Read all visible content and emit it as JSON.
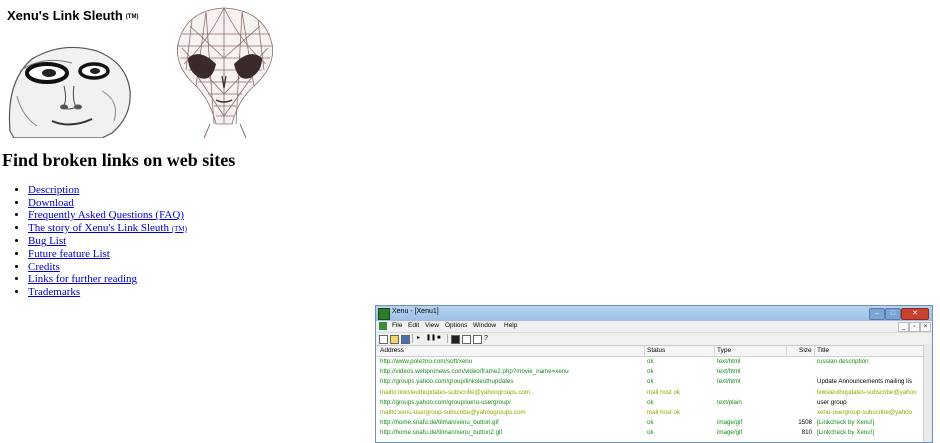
{
  "logo": {
    "title": "Xenu's Link Sleuth",
    "tm": "(TM)"
  },
  "headline": "Find broken links on web sites",
  "nav": {
    "items": [
      {
        "label": "Description"
      },
      {
        "label": "Download"
      },
      {
        "label": "Frequently Asked Questions (FAQ)"
      },
      {
        "label": "The story of Xenu's Link Sleuth",
        "suffix": "(TM)"
      },
      {
        "label": "Bug List"
      },
      {
        "label": "Future feature List"
      },
      {
        "label": "Credits"
      },
      {
        "label": "Links for further reading"
      },
      {
        "label": "Trademarks"
      }
    ]
  },
  "xenu_window": {
    "title": "Xenu - [Xenu1]",
    "menu": [
      "File",
      "Edit",
      "View",
      "Options",
      "Window",
      "Help"
    ],
    "columns": [
      "Address",
      "Status",
      "Type",
      "Size",
      "Title"
    ],
    "rows": [
      {
        "address": "http://www.polezno.com/soft/xenu",
        "status": "ok",
        "type": "text/html",
        "size": "",
        "title": "russian description",
        "kind": "ok"
      },
      {
        "address": "http://videos.webpronews.com/video/frame2.php?movie_name=xenu",
        "status": "ok",
        "type": "text/html",
        "size": "",
        "title": "",
        "kind": "ok"
      },
      {
        "address": "http://groups.yahoo.com/group/linksleuthupdates",
        "status": "ok",
        "type": "text/html",
        "size": "",
        "title": "Update Announcements mailing lis",
        "kind": "ok"
      },
      {
        "address": "mailto:linksleuthupdates-subscribe@yahoogroups.com",
        "status": "mail host ok",
        "type": "",
        "size": "",
        "title": "linksleuthupdates-subscribe@yahoo",
        "kind": "mail"
      },
      {
        "address": "http://groups.yahoo.com/group/xenu-usergroup/",
        "status": "ok",
        "type": "text/plain",
        "size": "",
        "title": "user group",
        "kind": "ok"
      },
      {
        "address": "mailto:xenu-usergroup-subscribe@yahoogroups.com",
        "status": "mail host ok",
        "type": "",
        "size": "",
        "title": "xenu-usergroup-subscribe@yahoo",
        "kind": "mail"
      },
      {
        "address": "http://home.snafu.de/tilman/xenu_button.gif",
        "status": "ok",
        "type": "image/gif",
        "size": "1508",
        "title": "[Linkcheck by Xenu!]",
        "kind": "ok"
      },
      {
        "address": "http://home.snafu.de/tilman/xenu_button2.gif",
        "status": "ok",
        "type": "image/gif",
        "size": "810",
        "title": "[Linkcheck by Xenu!]",
        "kind": "ok"
      }
    ]
  },
  "colors": {
    "link": "#0000cc",
    "ok_green": "#1a8a1a",
    "mail_olive": "#8fa800"
  },
  "icons": [
    "alien-photo-icon",
    "alien-wireframe-icon"
  ]
}
